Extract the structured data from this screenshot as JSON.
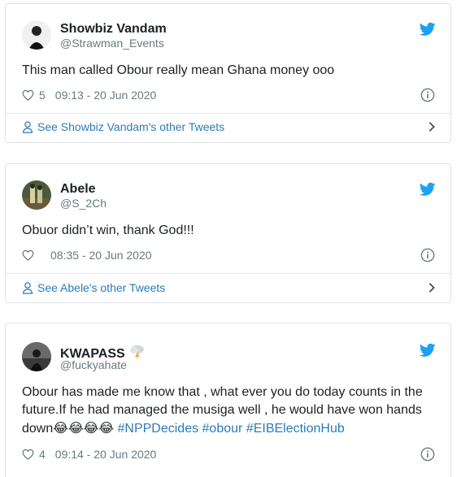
{
  "colors": {
    "link": "#2b7bb9",
    "muted": "#697882",
    "twitter_blue": "#1da1f2",
    "border": "#dfe3e6"
  },
  "tweets": [
    {
      "name": "Showbiz Vandam",
      "handle": "@Strawman_Events",
      "text": "This man called Obour really mean Ghana money ooo",
      "likes": "5",
      "timestamp": "09:13 - 20 Jun 2020",
      "more_link": "See Showbiz Vandam's other Tweets"
    },
    {
      "name": "Abele",
      "handle": "@S_2Ch",
      "text": "Obuor didn’t win, thank God!!!",
      "likes": "",
      "timestamp": "08:35 - 20 Jun 2020",
      "more_link": "See Abele's other Tweets"
    },
    {
      "name": "KWAPASS",
      "name_emoji": "⛈",
      "handle": "@fuckyahate",
      "text_line1": "Obour has made me know that , what ever you do today counts in the",
      "text_line2": "future.If he had managed the musiga well , he would have won hands",
      "text_line3_prefix": "down",
      "emojis": "😂😂😂😂",
      "hashtags": "#NPPDecides #obour #EIBElectionHub",
      "likes": "4",
      "timestamp": "09:14 - 20 Jun 2020"
    }
  ],
  "icons": [
    "twitter-bird-icon",
    "heart-icon",
    "info-icon",
    "person-icon",
    "chevron-right-icon",
    "storm-cloud-icon"
  ]
}
